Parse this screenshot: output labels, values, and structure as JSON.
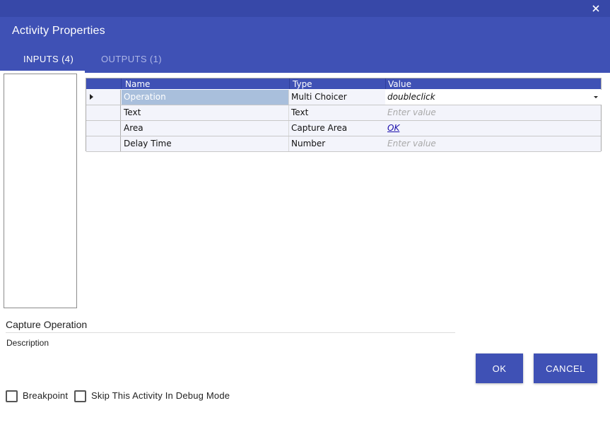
{
  "window": {
    "title": "Activity Properties",
    "close_icon": "close-icon"
  },
  "tabs": [
    {
      "label": "INPUTS (4)",
      "active": true
    },
    {
      "label": "OUTPUTS (1)",
      "active": false
    }
  ],
  "grid": {
    "columns": [
      "Name",
      "Type",
      "Value"
    ],
    "rows": [
      {
        "name": "Operation",
        "type": "Multi Choicer",
        "value": "doubleclick",
        "placeholder": "",
        "selected": true
      },
      {
        "name": "Text",
        "type": "Text",
        "value": "",
        "placeholder": "Enter value"
      },
      {
        "name": "Area",
        "type": "Capture Area",
        "value": "OK",
        "placeholder": ""
      },
      {
        "name": "Delay Time",
        "type": "Number",
        "value": "",
        "placeholder": "Enter value"
      }
    ]
  },
  "details": {
    "activity_name": "Capture Operation",
    "description": "Description"
  },
  "buttons": {
    "ok": "OK",
    "cancel": "CANCEL"
  },
  "options": {
    "breakpoint": "Breakpoint",
    "skip_debug": "Skip This Activity In Debug Mode"
  },
  "colors": {
    "accent": "#3f51b5",
    "selected_cell": "#a9bfdc"
  }
}
